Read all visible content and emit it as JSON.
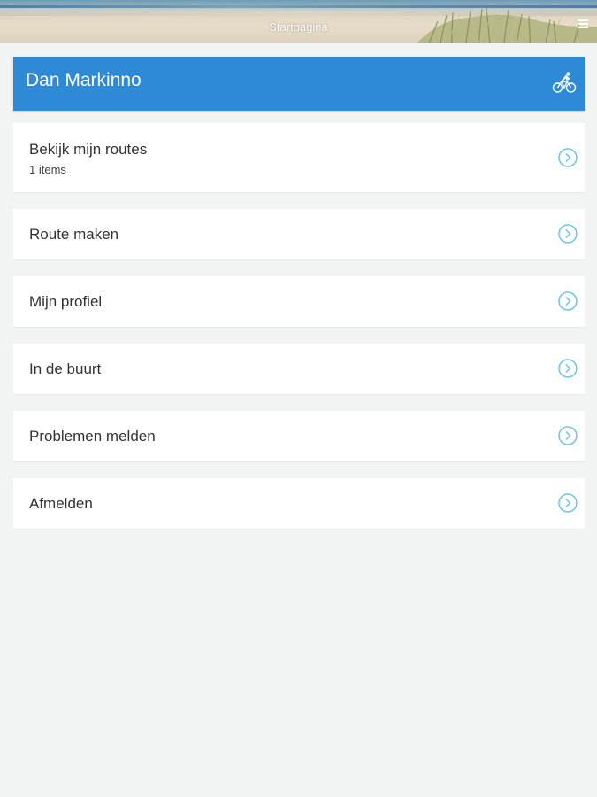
{
  "header": {
    "title": "Startpagina",
    "menu_icon": "hamburger-icon"
  },
  "user": {
    "name": "Dan Markinno",
    "icon": "bicycle-icon"
  },
  "menu": {
    "items": [
      {
        "label": "Bekijk mijn routes",
        "sub": "1 items"
      },
      {
        "label": "Route maken"
      },
      {
        "label": "Mijn profiel"
      },
      {
        "label": "In de buurt"
      },
      {
        "label": "Problemen melden"
      },
      {
        "label": "Afmelden"
      }
    ],
    "chevron_icon": "chevron-right-circle-icon"
  },
  "colors": {
    "accent": "#2e8ad6",
    "chevron": "#6fc3e8",
    "background": "#f2f3f3"
  }
}
